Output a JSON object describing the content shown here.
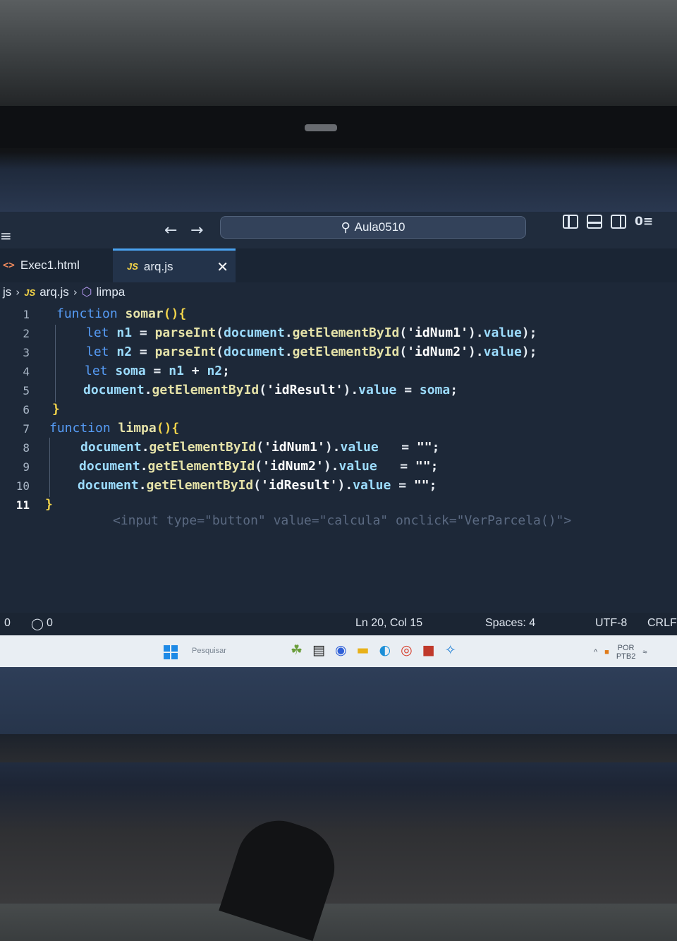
{
  "titlebar": {
    "menu_icon": "hamburger-menu-icon",
    "back_icon": "arrow-left-icon",
    "forward_icon": "arrow-right-icon",
    "search_label": "Aula0510"
  },
  "tabs": [
    {
      "label": "Exec1.html",
      "icon": "html-file-icon"
    },
    {
      "label": "arq.js",
      "icon": "js-file-icon",
      "active": true
    }
  ],
  "breadcrumb": {
    "folder": "js",
    "file": "arq.js",
    "symbol": "limpa"
  },
  "editor": {
    "line_numbers": [
      "1",
      "2",
      "3",
      "4",
      "5",
      "6",
      "7",
      "8",
      "9",
      "10",
      "11"
    ],
    "lines": [
      "function somar(){",
      "let n1 = parseInt(document.getElementById('idNum1').value);",
      "let n2 = parseInt(document.getElementById('idNum2').value);",
      "let soma = n1 + n2;",
      "document.getElementById('idResult').value = soma;",
      "}",
      "function limpa(){",
      "document.getElementById('idNum1').value   = \"\";",
      "document.getElementById('idNum2').value   = \"\";",
      "document.getElementById('idResult').value = \"\";",
      "}"
    ],
    "ghost_line": "<input type=\"button\" value=\"calcula\" onclick=\"VerParcela()\">"
  },
  "statusbar": {
    "errors": "0",
    "warnings": "0",
    "position": "Ln 20, Col 15",
    "spaces": "Spaces: 4",
    "encoding": "UTF-8",
    "eol": "CRLF"
  },
  "taskbar": {
    "search_placeholder": "Pesquisar",
    "tray_lang": "POR",
    "tray_layout": "PTB2"
  },
  "colors": {
    "keyword": "#569cf6",
    "brace": "#f2d44b",
    "editor_bg": "#1d2838",
    "tab_accent": "#4aa3f0"
  }
}
